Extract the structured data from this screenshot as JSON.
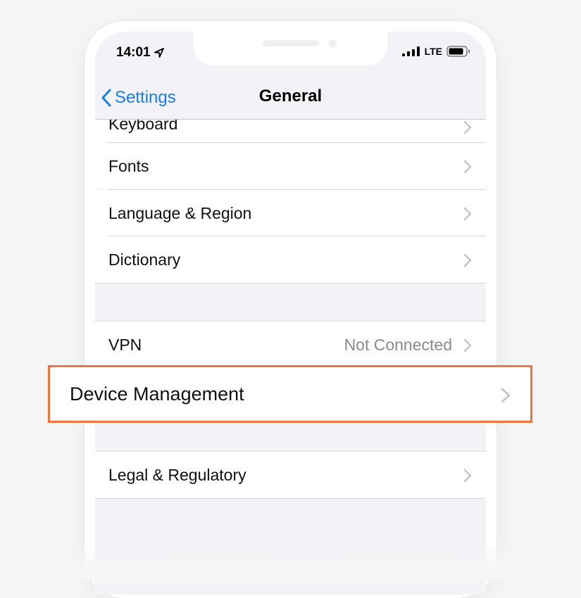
{
  "status_bar": {
    "time": "14:01",
    "network": "LTE"
  },
  "nav": {
    "back_label": "Settings",
    "title": "General"
  },
  "rows": {
    "keyboard": "Keyboard",
    "fonts": "Fonts",
    "language_region": "Language & Region",
    "dictionary": "Dictionary",
    "vpn": "VPN",
    "vpn_value": "Not Connected",
    "device_management": "Device Management",
    "legal_regulatory": "Legal & Regulatory"
  },
  "icons": {
    "location": "location-arrow-icon",
    "signal": "cellular-signal-icon",
    "battery": "battery-icon",
    "back": "chevron-left-icon",
    "disclosure": "chevron-right-icon"
  },
  "colors": {
    "accent": "#1a7cf5",
    "highlight_border": "#f0723d",
    "background": "#f2f2f7"
  }
}
